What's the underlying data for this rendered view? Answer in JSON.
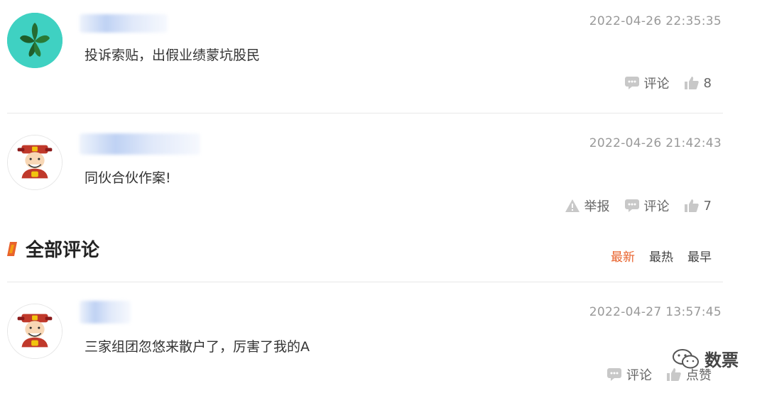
{
  "comments_top": [
    {
      "avatar": "leaf-avatar",
      "time": "2022-04-26 22:35:35",
      "text": "投诉索贴，出假业绩蒙坑股民",
      "comment_label": "评论",
      "likes": "8"
    },
    {
      "avatar": "fortune-god-avatar",
      "time": "2022-04-26 21:42:43",
      "text": "同伙合伙作案!",
      "report_label": "举报",
      "comment_label": "评论",
      "likes": "7"
    }
  ],
  "section": {
    "title": "全部评论",
    "sort_options": [
      "最新",
      "最热",
      "最早"
    ],
    "active_sort": "最新",
    "accent_color": "#e8622c"
  },
  "comments_all": [
    {
      "avatar": "fortune-god-avatar",
      "time": "2022-04-27 13:57:45",
      "text": "三家组团忽悠来散户了，厉害了我的A",
      "comment_label": "评论",
      "like_label": "点赞"
    }
  ],
  "watermark": {
    "text": "数票",
    "icon": "wechat-icon"
  }
}
